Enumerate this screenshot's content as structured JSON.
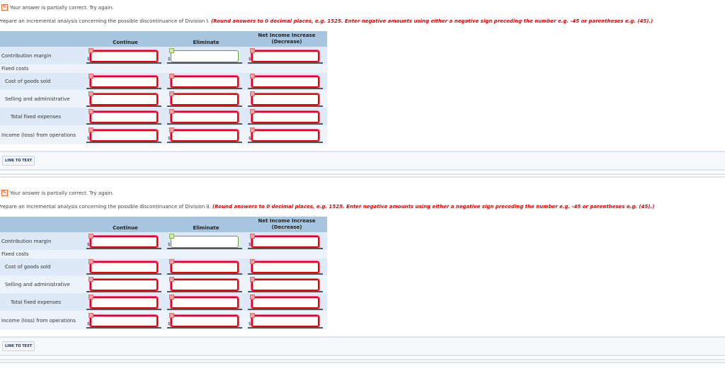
{
  "status_text": "Your answer is partially correct.  Try again.",
  "columns": [
    "Continue",
    "Eliminate",
    "Net Income Increase (Decrease)"
  ],
  "rounding_note": "(Round answers to 0 decimal places, e.g. 1525. Enter negative amounts using either a negative sign preceding the number e.g. -45 or parentheses e.g. (45).)",
  "link_label": "LINK TO TEXT",
  "currency_symbol": "$",
  "rows": [
    {
      "label": "Contribution margin",
      "dollar": true,
      "inputs": true
    },
    {
      "label": "Fixed costs",
      "dollar": false,
      "inputs": false
    },
    {
      "label": "Cost of goods sold",
      "dollar": false,
      "inputs": true
    },
    {
      "label": "Selling and administrative",
      "dollar": false,
      "inputs": true
    },
    {
      "label": "Total fixed expenses",
      "dollar": false,
      "inputs": true
    },
    {
      "label": "Income (loss) from operations",
      "dollar": true,
      "inputs": true
    }
  ],
  "sections": [
    {
      "instruction": "Prepare an incremental analysis concerning the possible discontinuance of Division I.",
      "values": [
        "",
        "",
        ""
      ]
    },
    {
      "instruction": "Prepare an incremental analysis concerning the possible discontinuance of Division II.",
      "values": [
        "",
        "",
        ""
      ]
    }
  ]
}
